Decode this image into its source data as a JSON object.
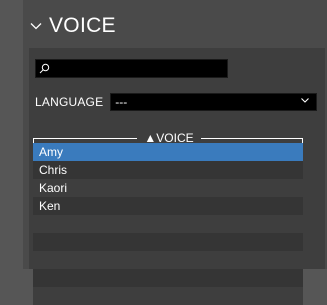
{
  "panel": {
    "title": "VOICE"
  },
  "search": {
    "value": "",
    "placeholder": ""
  },
  "language": {
    "label": "LANGUAGE",
    "selected": "---"
  },
  "voice_list": {
    "legend": "▲VOICE",
    "selected_index": 0,
    "items": [
      {
        "label": "Amy"
      },
      {
        "label": "Chris"
      },
      {
        "label": "Kaori"
      },
      {
        "label": "Ken"
      },
      {
        "label": ""
      },
      {
        "label": ""
      },
      {
        "label": ""
      },
      {
        "label": ""
      },
      {
        "label": ""
      }
    ]
  },
  "colors": {
    "selection": "#3a7bbd",
    "panel_bg": "#4a4a4a",
    "content_bg": "#3e3e3e"
  }
}
